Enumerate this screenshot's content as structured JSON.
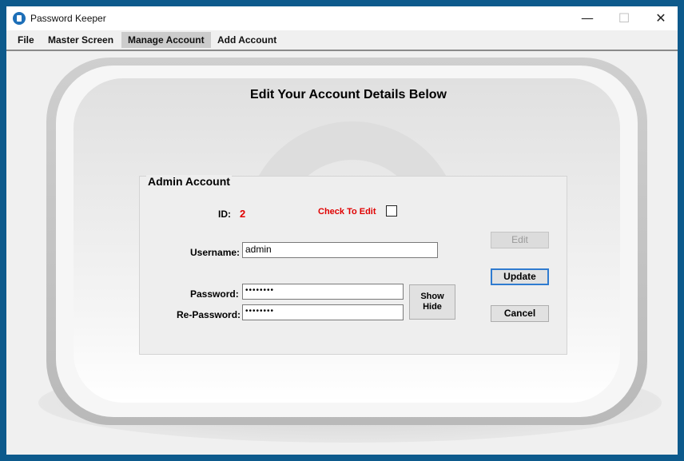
{
  "window": {
    "title": "Password Keeper",
    "controls": {
      "minimize": "—",
      "maximize": "☐",
      "close": "✕"
    }
  },
  "menu": {
    "items": [
      {
        "label": "File"
      },
      {
        "label": "Master Screen"
      },
      {
        "label": "Manage Account",
        "active": true
      },
      {
        "label": "Add Account"
      }
    ]
  },
  "main": {
    "heading": "Edit Your Account Details Below",
    "group": {
      "title": "Admin Account",
      "id_label": "ID:",
      "id_value": "2",
      "check_to_edit_label": "Check To Edit",
      "check_to_edit_checked": false,
      "username_label": "Username:",
      "username_value": "admin",
      "password_label": "Password:",
      "password_value": "••••••••",
      "repassword_label": "Re-Password:",
      "repassword_value": "••••••••",
      "show_hide_line1": "Show",
      "show_hide_line2": "Hide",
      "edit_button": "Edit",
      "update_button": "Update",
      "cancel_button": "Cancel"
    }
  },
  "colors": {
    "accent_red": "#e00000",
    "window_border": "#0d5a8c",
    "default_button_border": "#2f7bd0"
  }
}
